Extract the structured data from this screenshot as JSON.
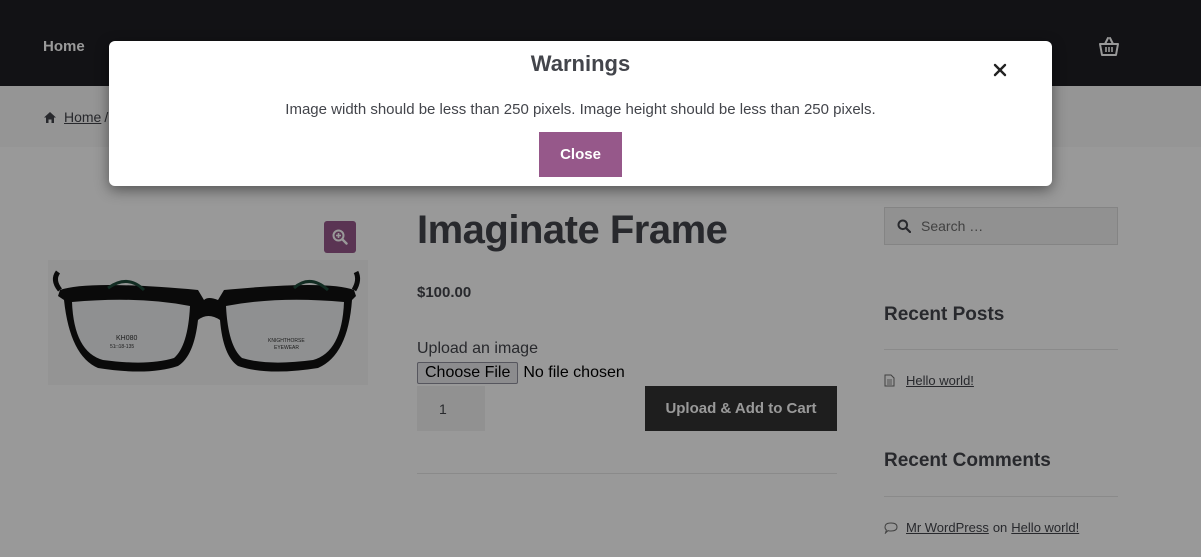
{
  "header": {
    "nav_home": "Home"
  },
  "breadcrumb": {
    "home": "Home",
    "separator": "/"
  },
  "product": {
    "title": "Imaginate Frame",
    "price": "$100.00",
    "upload_label": "Upload an image",
    "choose_file_label": "Choose File",
    "no_file_text": "No file chosen",
    "quantity": "1",
    "add_to_cart_label": "Upload & Add to Cart",
    "frame_text_left": "KH080",
    "frame_text_left_sub": "51□18-135",
    "frame_text_right": "KNIGHTHORSE",
    "frame_text_right_sub": "EYEWEAR"
  },
  "sidebar": {
    "search_placeholder": "Search …",
    "recent_posts_title": "Recent Posts",
    "recent_posts": [
      {
        "title": "Hello world!"
      }
    ],
    "recent_comments_title": "Recent Comments",
    "recent_comments": [
      {
        "author": "Mr WordPress",
        "connector": "on",
        "post": "Hello world!"
      }
    ]
  },
  "modal": {
    "title": "Warnings",
    "message": "Image width should be less than 250 pixels. Image height should be less than 250 pixels.",
    "close_label": "Close"
  },
  "colors": {
    "header_bg": "#1e1f24",
    "accent": "#96588a",
    "button_dark": "#333333",
    "text": "#43454b"
  }
}
